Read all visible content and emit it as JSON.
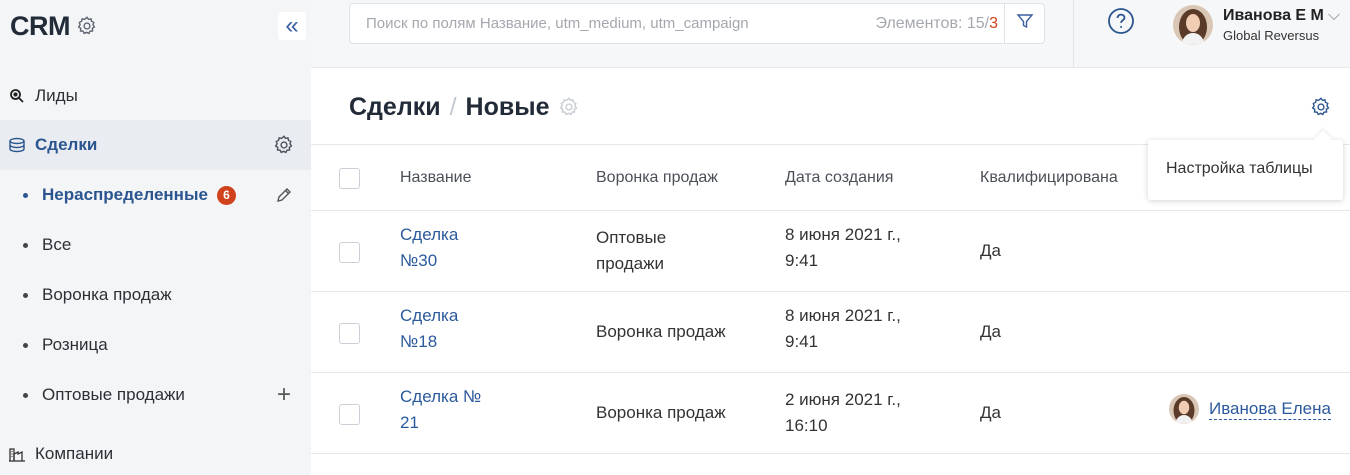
{
  "app": {
    "logo": "CRM"
  },
  "colors": {
    "accent": "#2b5590",
    "badge": "#d0421b",
    "link": "#2b5a9c"
  },
  "sidebar": {
    "collapse_icon": "«",
    "items": [
      {
        "label": "Лиды",
        "icon": "search-leads-icon"
      },
      {
        "label": "Сделки",
        "icon": "deals-icon",
        "active": true
      },
      {
        "label": "Компании",
        "icon": "companies-icon"
      }
    ],
    "sub_items": [
      {
        "label": "Нераспределенные",
        "badge": "6",
        "active": true
      },
      {
        "label": "Все"
      },
      {
        "label": "Воронка продаж"
      },
      {
        "label": "Розница"
      },
      {
        "label": "Оптовые продажи"
      }
    ],
    "add_icon": "+"
  },
  "search": {
    "placeholder": "Поиск по полям Название, utm_medium, utm_campaign",
    "count_label": "Элементов: 15",
    "count_sep": "/",
    "count_extra": "3"
  },
  "user": {
    "name": "Иванова Е М",
    "company": "Global Reversus",
    "chevron": "⌵"
  },
  "page": {
    "title": "Сделки",
    "separator": "/",
    "subtitle": "Новые"
  },
  "table": {
    "columns": [
      "Название",
      "Воронка продаж",
      "Дата создания",
      "Квалифицирована"
    ],
    "rows": [
      {
        "name_line1": "Сделка",
        "name_line2": "№30",
        "funnel_line1": "Оптовые",
        "funnel_line2": "продажи",
        "date_line1": "8 июня 2021 г.,",
        "date_line2": "9:41",
        "qualified": "Да",
        "owner": ""
      },
      {
        "name_line1": "Сделка",
        "name_line2": "№18",
        "funnel_line1": "Воронка продаж",
        "funnel_line2": "",
        "date_line1": "8 июня 2021 г.,",
        "date_line2": "9:41",
        "qualified": "Да",
        "owner": ""
      },
      {
        "name_line1": "Сделка №",
        "name_line2": "21",
        "funnel_line1": "Воронка продаж",
        "funnel_line2": "",
        "date_line1": "2 июня 2021 г.,",
        "date_line2": "16:10",
        "qualified": "Да",
        "owner": "Иванова Елена"
      }
    ]
  },
  "popup": {
    "text": "Настройка таблицы"
  }
}
